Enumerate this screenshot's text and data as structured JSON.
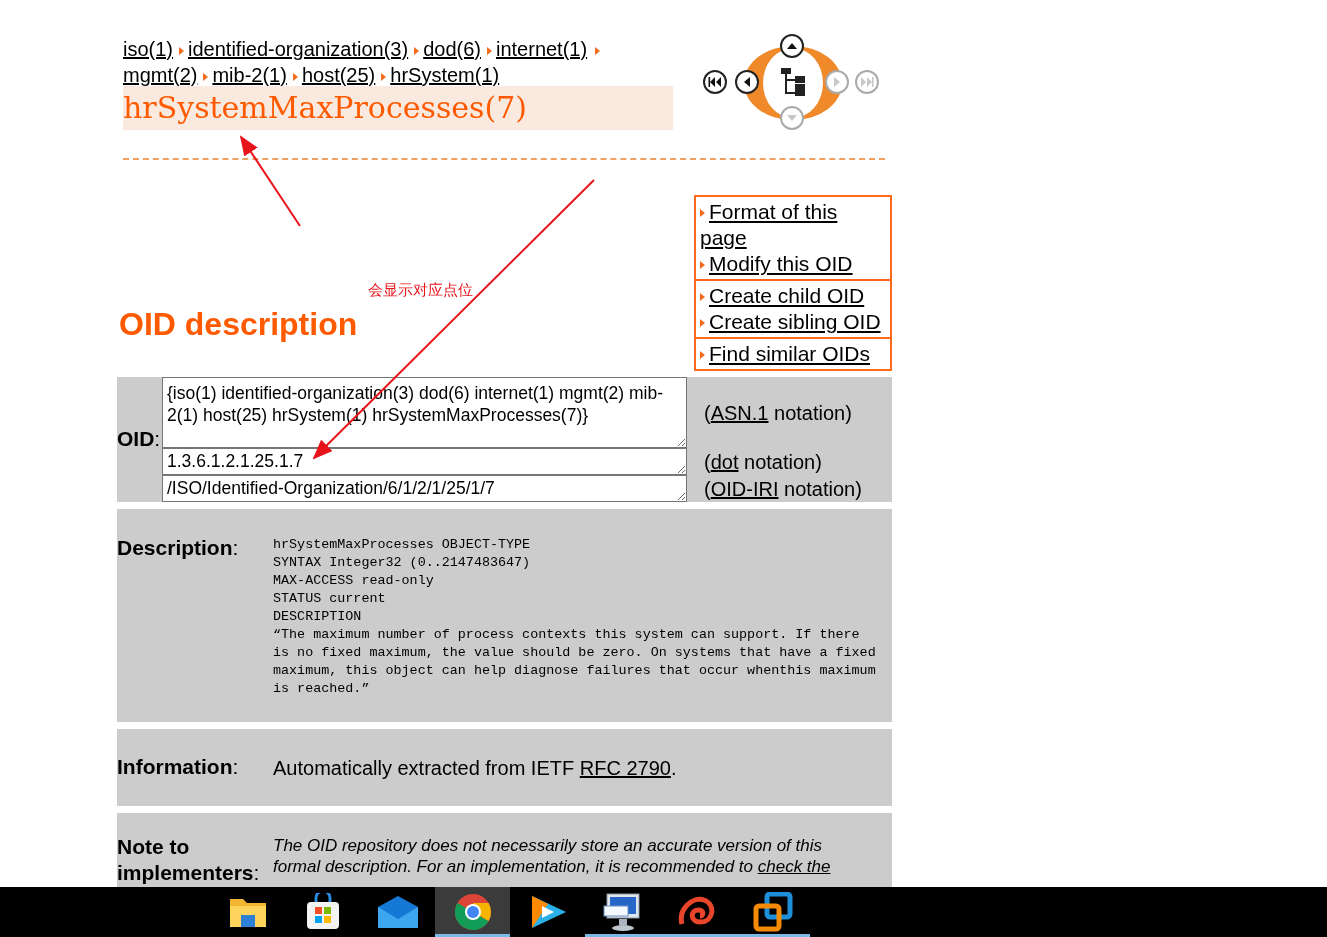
{
  "breadcrumb": [
    {
      "label": "iso(1)"
    },
    {
      "label": "identified-organization(3)"
    },
    {
      "label": "dod(6)"
    },
    {
      "label": "internet(1)"
    },
    {
      "label": "mgmt(2)"
    },
    {
      "label": "mib-2(1)"
    },
    {
      "label": "host(25)"
    },
    {
      "label": "hrSystem(1)"
    }
  ],
  "title": "hrSystemMaxProcesses(7)",
  "nav_buttons": [
    {
      "kind": "first",
      "disabled": false
    },
    {
      "kind": "previous",
      "disabled": false
    },
    {
      "kind": "up",
      "disabled": false
    },
    {
      "kind": "down",
      "disabled": true
    },
    {
      "kind": "next",
      "disabled": true
    },
    {
      "kind": "last",
      "disabled": true
    }
  ],
  "menu": [
    [
      "Format of this page",
      "Modify this OID"
    ],
    [
      "Create child OID",
      "Create sibling OID"
    ],
    [
      "Find similar OIDs"
    ]
  ],
  "heading": "OID description",
  "annotation": {
    "text": "会显示对应点位"
  },
  "oid": {
    "label": "**OID**:",
    "rows": [
      {
        "kind": "tall",
        "value": "{iso(1) identified-organization(3) dod(6) internet(1) mgmt(2) mib-2(1) host(25) hrSystem(1) hrSystemMaxProcesses(7)}",
        "before": "(",
        "link": "ASN.1",
        "after": " notation)"
      },
      {
        "kind": "short",
        "value": "1.3.6.1.2.1.25.1.7",
        "before": "(",
        "link": "dot",
        "after": " notation)"
      },
      {
        "kind": "short",
        "value": "/ISO/Identified-Organization/6/1/2/1/25/1/7",
        "before": "(",
        "link": "OID-IRI",
        "after": " notation)"
      }
    ]
  },
  "description": {
    "label": "**Description**:",
    "text": "hrSystemMaxProcesses OBJECT-TYPE\nSYNTAX Integer32 (0..2147483647)\nMAX-ACCESS read-only\nSTATUS current\nDESCRIPTION\n“The maximum number of process contexts this system can support. If there\nis no fixed maximum, the value should be zero. On systems that have a fixed\nmaximum, this object can help diagnose failures that occur whenthis maximum\nis reached.”"
  },
  "information": {
    "label": "**Information**:",
    "before": "Automatically extracted from IETF ",
    "link": "RFC 2790",
    "after": "."
  },
  "note": {
    "label": "**Note to implementers**:",
    "text": "The OID repository does not necessarily store an accurate version of this formal description. For an implementation, it is recommended to ",
    "link": "check the"
  },
  "taskbar": [
    {
      "kind": "folder",
      "selected": false,
      "running": false
    },
    {
      "kind": "store",
      "selected": false,
      "running": false
    },
    {
      "kind": "mail",
      "selected": false,
      "running": false
    },
    {
      "kind": "chrome",
      "selected": true,
      "running": true
    },
    {
      "kind": "video",
      "selected": false,
      "running": false
    },
    {
      "kind": "monitor",
      "selected": false,
      "running": true
    },
    {
      "kind": "swirl",
      "selected": false,
      "running": true
    },
    {
      "kind": "vm",
      "selected": false,
      "running": true
    }
  ]
}
